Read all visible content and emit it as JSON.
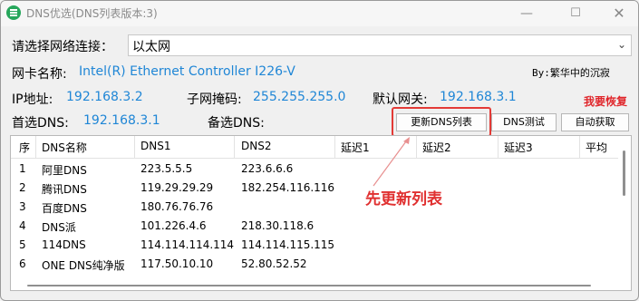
{
  "window": {
    "title": "DNS优选(DNS列表版本:3)"
  },
  "network": {
    "select_label": "请选择网络连接：",
    "selected": "以太网",
    "adapter_label": "网卡名称:",
    "adapter_value": "Intel(R) Ethernet Controller I226-V",
    "ip_label": "IP地址:",
    "ip_value": "192.168.3.2",
    "mask_label": "子网掩码:",
    "mask_value": "255.255.255.0",
    "gateway_label": "默认网关:",
    "gateway_value": "192.168.3.1",
    "dns1_label": "首选DNS:",
    "dns1_value": "192.168.3.1",
    "dns2_label": "备选DNS:"
  },
  "author": "By:繁华中的沉寂",
  "restore_link": "我要恢复",
  "buttons": {
    "update": "更新DNS列表",
    "test": "DNS测试",
    "auto": "自动获取"
  },
  "table": {
    "headers": [
      "序",
      "DNS名称",
      "DNS1",
      "DNS2",
      "延迟1",
      "延迟2",
      "延迟3",
      "平均"
    ],
    "rows": [
      [
        "1",
        "阿里DNS",
        "223.5.5.5",
        "223.6.6.6"
      ],
      [
        "2",
        "腾讯DNS",
        "119.29.29.29",
        "182.254.116.116"
      ],
      [
        "3",
        "百度DNS",
        "180.76.76.76",
        ""
      ],
      [
        "4",
        "DNS派",
        "101.226.4.6",
        "218.30.118.6"
      ],
      [
        "5",
        "114DNS",
        "114.114.114.114",
        "114.114.115.115"
      ],
      [
        "6",
        "ONE DNS纯净版",
        "117.50.10.10",
        "52.80.52.52"
      ]
    ]
  },
  "annotation": "先更新列表",
  "colors": {
    "value_blue": "#1f86d6",
    "annotation_red": "#e33a36"
  }
}
